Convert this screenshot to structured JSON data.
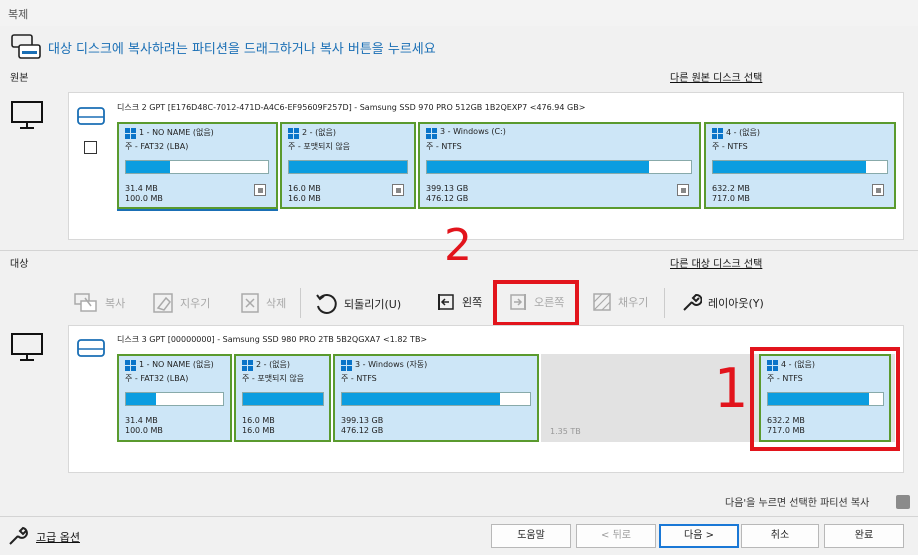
{
  "window": {
    "title": "복제"
  },
  "instruction": "대상 디스크에 복사하려는 파티션을 드래그하거나 복사 버튼을 누르세요",
  "source": {
    "label": "원본",
    "select_link": "다른 원본 디스크 선택",
    "disk_title": "디스크 2 GPT [E176D48C-7012-471D-A4C6-EF95609F257D] - Samsung SSD 970 PRO 512GB 1B2QEXP7  <476.94 GB>",
    "partitions": [
      {
        "name": "1 - NO NAME (없음)",
        "fs": "주 - FAT32 (LBA)",
        "used": "31.4 MB",
        "total": "100.0 MB",
        "fill": 0.31
      },
      {
        "name": "2 - (없음)",
        "fs": "주 - 포맷되지 않음",
        "used": "16.0 MB",
        "total": "16.0 MB",
        "fill": 1.0
      },
      {
        "name": "3 - Windows (C:)",
        "fs": "주 - NTFS",
        "used": "399.13 GB",
        "total": "476.12 GB",
        "fill": 0.84
      },
      {
        "name": "4 - (없음)",
        "fs": "주 - NTFS",
        "used": "632.2 MB",
        "total": "717.0 MB",
        "fill": 0.88
      }
    ]
  },
  "target": {
    "label": "대상",
    "select_link": "다른 대상 디스크 선택",
    "disk_title": "디스크 3 GPT [00000000] - Samsung SSD 980 PRO 2TB 5B2QGXA7  <1.82 TB>",
    "partitions": [
      {
        "name": "1 - NO NAME (없음)",
        "fs": "주 - FAT32 (LBA)",
        "used": "31.4 MB",
        "total": "100.0 MB",
        "fill": 0.31
      },
      {
        "name": "2 - (없음)",
        "fs": "주 - 포맷되지 않음",
        "used": "16.0 MB",
        "total": "16.0 MB",
        "fill": 1.0
      },
      {
        "name": "3 - Windows (자동)",
        "fs": "주 - NTFS",
        "used": "399.13 GB",
        "total": "476.12 GB",
        "fill": 0.84
      },
      {
        "name": "4 - (없음)",
        "fs": "주 - NTFS",
        "used": "632.2 MB",
        "total": "717.0 MB",
        "fill": 0.88
      }
    ],
    "unallocated": "1.35 TB"
  },
  "toolbar": {
    "copy": "복사",
    "erase": "지우기",
    "delete": "삭제",
    "undo": "되돌리기(U)",
    "left": "왼쪽",
    "right": "오른쪽",
    "fill": "채우기",
    "layout": "레이아웃(Y)"
  },
  "annotations": {
    "step2": "2",
    "step1": "1"
  },
  "hint": "다음'을 누르면 선택한 파티션 복사",
  "footer": {
    "advanced": "고급 옵션",
    "help": "도움말",
    "back": "< 뒤로",
    "next": "다음 >",
    "cancel": "취소",
    "finish": "완료"
  },
  "colors": {
    "accent": "#1a6fb5",
    "partition_border": "#5a9a2e",
    "partition_bg": "#cde6f7",
    "usage_bar": "#0b9de0",
    "highlight": "#e2141c"
  }
}
